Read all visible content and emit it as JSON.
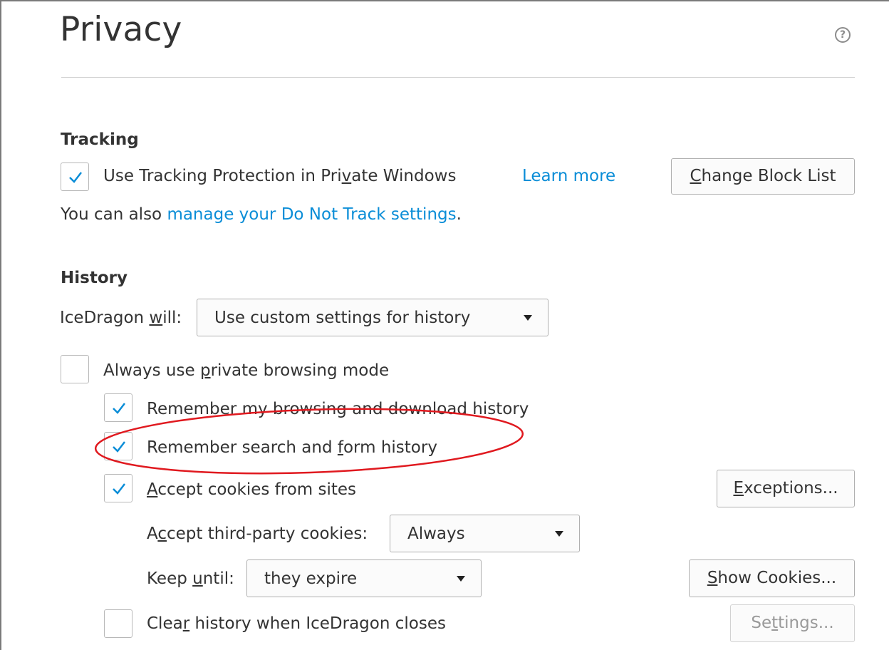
{
  "page": {
    "title": "Privacy",
    "help_icon": "question-circle-icon"
  },
  "tracking": {
    "heading": "Tracking",
    "use_tp_label": "Use Tracking Protection in Private Windows",
    "use_tp_checked": true,
    "learn_more": "Learn more",
    "change_block_list": "Change Block List",
    "dnt_prefix": "You can also ",
    "dnt_link": "manage your Do Not Track settings",
    "dnt_suffix": "."
  },
  "history": {
    "heading": "History",
    "will_label": "IceDragon will:",
    "will_value": "Use custom settings for history",
    "always_private_label": "Always use private browsing mode",
    "always_private_checked": false,
    "remember_browsing_label": "Remember my browsing and download history",
    "remember_browsing_checked": true,
    "remember_search_label": "Remember search and form history",
    "remember_search_checked": true,
    "accept_cookies_label": "Accept cookies from sites",
    "accept_cookies_checked": true,
    "exceptions_button": "Exceptions...",
    "third_party_label": "Accept third-party cookies:",
    "third_party_value": "Always",
    "keep_until_label": "Keep until:",
    "keep_until_value": "they expire",
    "show_cookies_button": "Show Cookies...",
    "clear_history_label": "Clear history when IceDragon closes",
    "clear_history_checked": false,
    "settings_button": "Settings..."
  },
  "colors": {
    "link": "#0a8dd7",
    "check": "#0a8dd7",
    "highlight_ellipse": "#e0191f"
  }
}
